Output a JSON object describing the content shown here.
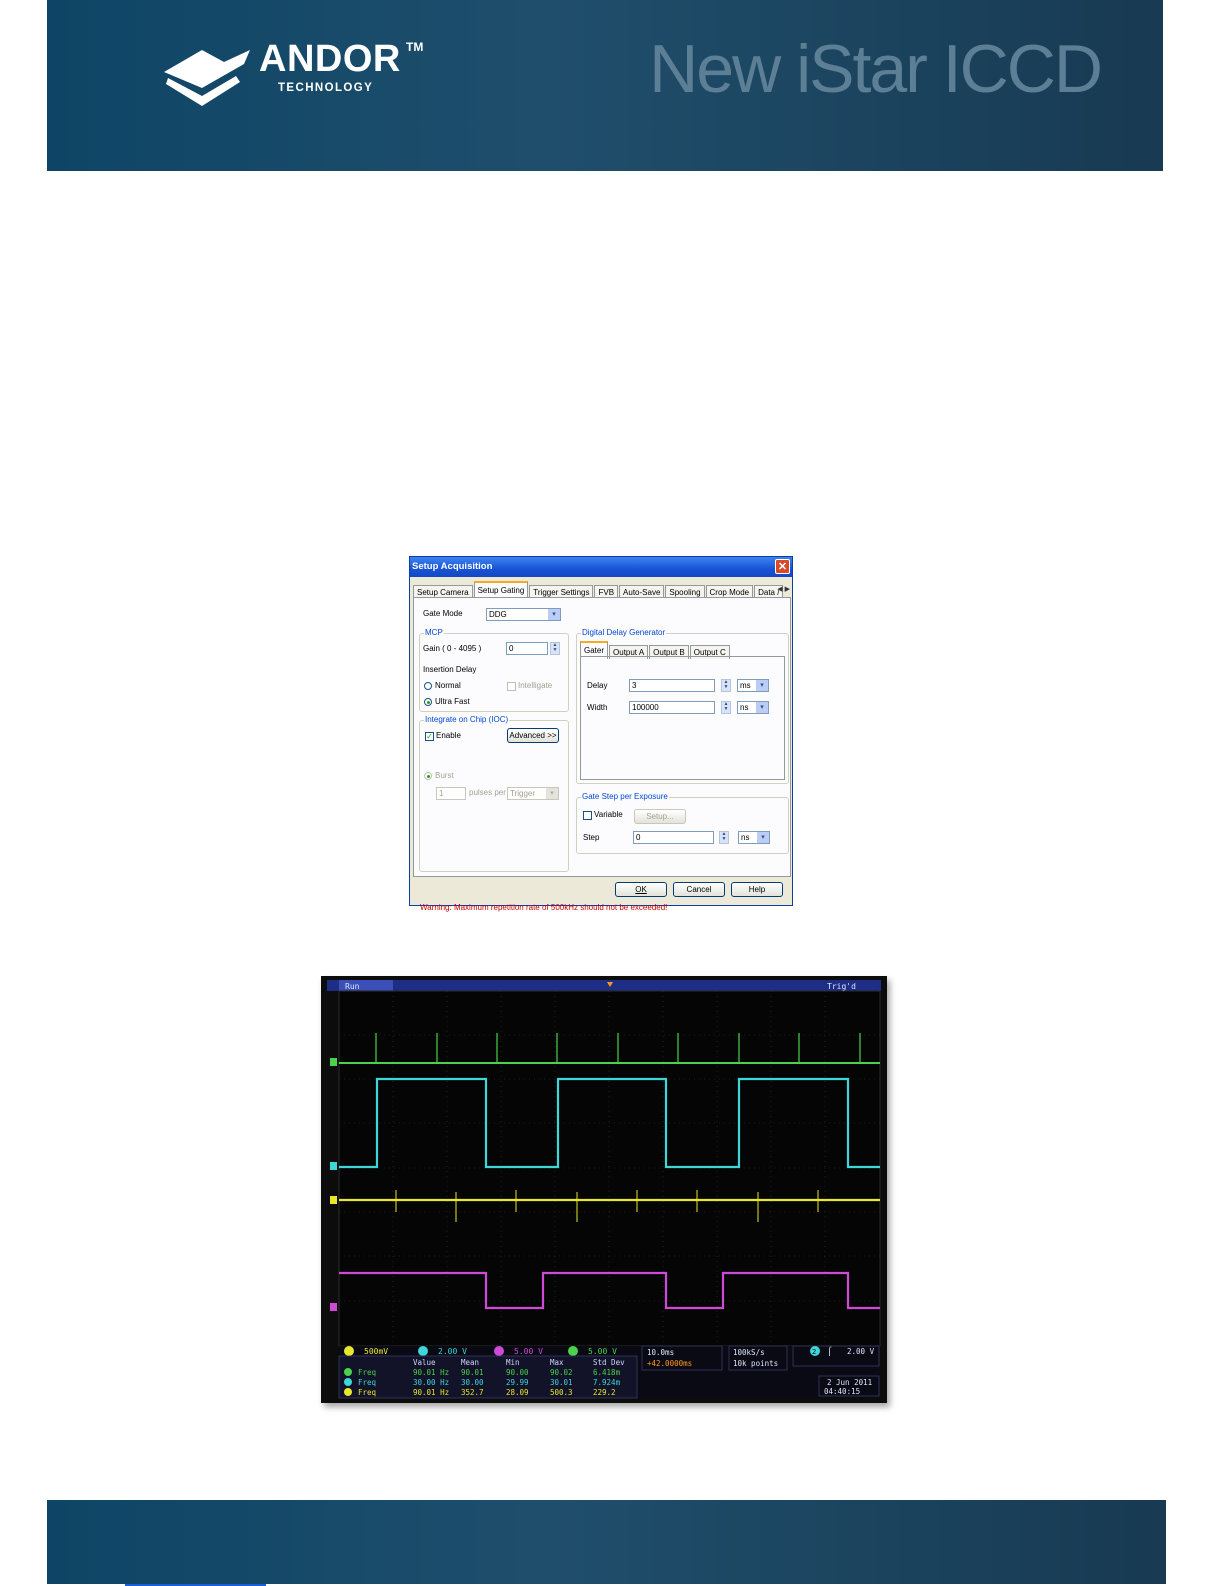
{
  "header": {
    "logo_word": "ANDOR",
    "logo_tm": "TM",
    "logo_sub": "TECHNOLOGY",
    "title": "New iStar ICCD"
  },
  "dialog": {
    "title": "Setup Acquisition",
    "close": "✕",
    "tabs": [
      "Setup Camera",
      "Setup Gating",
      "Trigger Settings",
      "FVB",
      "Auto-Save",
      "Spooling",
      "Crop Mode",
      "Data /"
    ],
    "gate_mode_label": "Gate Mode",
    "gate_mode_value": "DDG",
    "mcp_group": "MCP",
    "gain_label": "Gain ( 0 - 4095 )",
    "gain_value": "0",
    "insertion_delay_label": "Insertion Delay",
    "normal_label": "Normal",
    "intelligate_label": "Intelligate",
    "ultrafast_label": "Ultra Fast",
    "ioc_group": "Integrate on Chip (IOC)",
    "enable_label": "Enable",
    "advanced_button": "Advanced >>",
    "burst_label": "Burst",
    "burst_value": "1",
    "pulses_per_label": "pulses per",
    "trigger_value": "Trigger",
    "ddg_group": "Digital Delay Generator",
    "ddg_tabs": [
      "Gater",
      "Output A",
      "Output B",
      "Output C"
    ],
    "delay_label": "Delay",
    "delay_value": "3",
    "delay_unit": "ms",
    "width_label": "Width",
    "width_value": "100000",
    "width_unit": "ns",
    "gatestep_group": "Gate Step per Exposure",
    "variable_label": "Variable",
    "setup_button": "Setup...",
    "step_label": "Step",
    "step_value": "0",
    "step_unit": "ns",
    "warning": "Warning: Maximum repetition rate of 500kHz should not be exceeded!",
    "ok_button": "OK",
    "cancel_button": "Cancel",
    "help_button": "Help"
  },
  "scope": {
    "status_run": "Run",
    "status_trig": "Trig'd",
    "ch1_scale": "500mV",
    "ch2_scale": "2.00 V",
    "ch3_scale": "5.00 V",
    "ch4_scale": "5.00 V",
    "meas_headers": [
      "Value",
      "Mean",
      "Min",
      "Max",
      "Std Dev"
    ],
    "meas_rows": [
      {
        "ch": "4",
        "name": "Freq",
        "value": "90.01 Hz",
        "mean": "90.01",
        "min": "90.00",
        "max": "90.02",
        "std": "6.418m"
      },
      {
        "ch": "2",
        "name": "Freq",
        "value": "30.00 Hz",
        "mean": "30.00",
        "min": "29.99",
        "max": "30.01",
        "std": "7.924m"
      },
      {
        "ch": "1",
        "name": "Freq",
        "value": "90.01 Hz",
        "mean": "352.7",
        "min": "28.09",
        "max": "500.3",
        "std": "229.2"
      }
    ],
    "timebase": "10.0ms",
    "delay": "+42.0000ms",
    "sample_rate": "100kS/s",
    "record_length": "10k points",
    "trig_ch": "2",
    "trig_level": "2.00 V",
    "date": "2 Jun 2011",
    "time": "04:40:15",
    "colors": {
      "ch1": "#e8e82a",
      "ch2": "#3ed6d6",
      "ch3": "#d04ad8",
      "ch4": "#4ad24a"
    }
  }
}
